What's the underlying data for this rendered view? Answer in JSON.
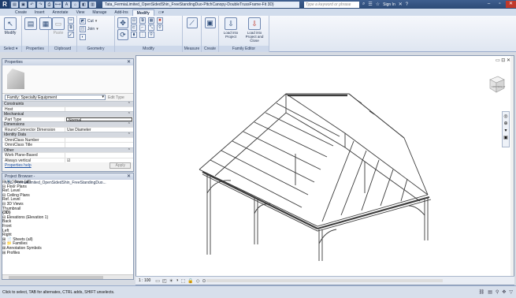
{
  "titlebar": {
    "logo": "R",
    "window_title": "Tata_FermiaLimited_OpenSidedShin_FreeStandingDuo-PitchCanopy-DoubleTrussFrame-Fit 3D}",
    "search_placeholder": "Type a keyword or phrase",
    "signin": "Sign In",
    "qat_icons": [
      "open-icon",
      "save-icon",
      "undo-icon",
      "redo-icon",
      "print-icon",
      "measure-icon",
      "text-icon",
      "3d-view-icon",
      "sections-icon",
      "switch-windows-icon"
    ]
  },
  "ribbon_tabs": [
    "Create",
    "Insert",
    "Annotate",
    "View",
    "Manage",
    "Add-Ins",
    "Modify"
  ],
  "active_tab": "Modify",
  "ribbon": {
    "select": {
      "label": "Select ▾",
      "modify": "Modify"
    },
    "properties": {
      "label": "Properties"
    },
    "clipboard": {
      "label": "Clipboard",
      "paste": "Paste"
    },
    "geometry": {
      "label": "Geometry",
      "cut": "Cut",
      "join": "Join"
    },
    "modify": {
      "label": "Modify"
    },
    "measure": {
      "label": "Measure"
    },
    "create": {
      "label": "Create"
    },
    "family_editor": {
      "label": "Family Editor",
      "load_project": "Load into Project",
      "load_close": "Load into Project and Close"
    }
  },
  "properties": {
    "title": "Properties",
    "family_select": "Family: Specialty Equipment",
    "edit_type": "Edit Type",
    "groups": [
      {
        "name": "Constraints",
        "rows": [
          {
            "name": "Host",
            "value": ""
          }
        ]
      },
      {
        "name": "Mechanical",
        "rows": [
          {
            "name": "Part Type",
            "value": "Normal"
          }
        ]
      },
      {
        "name": "Dimensions",
        "rows": [
          {
            "name": "Round Connector Dimension",
            "value": "Use Diameter"
          }
        ]
      },
      {
        "name": "Identity Data",
        "rows": [
          {
            "name": "OmniClass Number",
            "value": ""
          },
          {
            "name": "OmniClass Title",
            "value": ""
          }
        ]
      },
      {
        "name": "Other",
        "rows": [
          {
            "name": "Work Plane-Based",
            "value": ""
          },
          {
            "name": "Always vertical",
            "value": "☑"
          }
        ]
      }
    ],
    "help": "Properties help",
    "apply": "Apply"
  },
  "browser": {
    "title": "Project Browser - NBS_FermiaLimited_OpenSidedShin_FreeStandingDuo...",
    "items": [
      "⊟ 🔍 Views (all)",
      "   ⊟ Floor Plans",
      "        Ref. Level",
      "   ⊟ Ceiling Plans",
      "        Ref. Level",
      "   ⊟ 3D Views",
      "        Thumbnail",
      "        {3D}",
      "   ⊟ Elevations (Elevation 1)",
      "        Back",
      "        Front",
      "        Left",
      "        Right",
      "⊞ 📄 Sheets (all)",
      "⊟ 📁 Families",
      "   ⊞ Annotation Symbols",
      "   ⊞ Profiles"
    ]
  },
  "viewbar": {
    "scale": "1 : 100"
  },
  "status": {
    "text": "Click to select, TAB for alternates, CTRL adds, SHIFT unselects."
  },
  "colors": {
    "accent": "#2c4a76",
    "model_line": "#3a3a3a"
  }
}
